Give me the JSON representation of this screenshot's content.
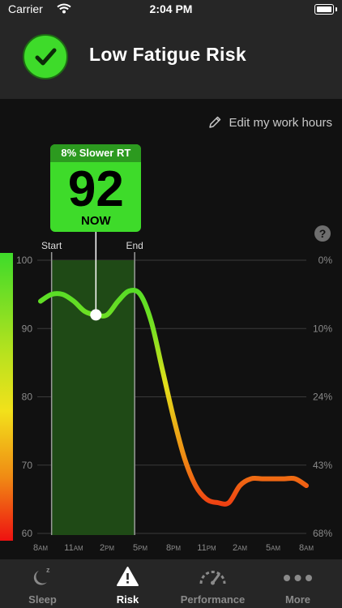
{
  "status": {
    "carrier": "Carrier",
    "time": "2:04 PM"
  },
  "header": {
    "title": "Low Fatigue Risk"
  },
  "edit_link": "Edit my work hours",
  "help": "?",
  "callout": {
    "top": "8% Slower RT",
    "value": "92",
    "now": "NOW"
  },
  "colors": {
    "good": "#3edb2a",
    "warn": "#f2e11b",
    "bad": "#ee1111"
  },
  "chart_data": {
    "type": "line",
    "x_tick_labels": [
      "8AM",
      "11AM",
      "2PM",
      "5PM",
      "8PM",
      "11PM",
      "2AM",
      "5AM",
      "8AM"
    ],
    "left_axis": {
      "ticks": [
        100,
        90,
        80,
        70,
        60
      ],
      "range": [
        60,
        100
      ]
    },
    "right_axis": {
      "ticks": [
        "0%",
        "10%",
        "24%",
        "43%",
        "68%"
      ]
    },
    "work_hours": {
      "start": "Start",
      "end": "End",
      "from_hours": 1,
      "to_hours": 8.5
    },
    "now": {
      "hours_since_8am": 5,
      "value": 92
    },
    "x_hours": [
      0,
      1,
      2,
      3,
      4,
      5,
      6,
      7,
      8,
      9,
      10,
      11,
      12,
      13,
      14,
      15,
      16,
      17,
      18,
      19,
      20,
      21,
      22,
      23,
      24
    ],
    "values": [
      94,
      95,
      95,
      94,
      92.5,
      92,
      92,
      94,
      95.5,
      95,
      91,
      84,
      77,
      71,
      67,
      65,
      64.5,
      64.5,
      67,
      68,
      68,
      68,
      68,
      68,
      67
    ]
  },
  "tabs": [
    {
      "label": "Sleep"
    },
    {
      "label": "Risk"
    },
    {
      "label": "Performance"
    },
    {
      "label": "More"
    }
  ]
}
